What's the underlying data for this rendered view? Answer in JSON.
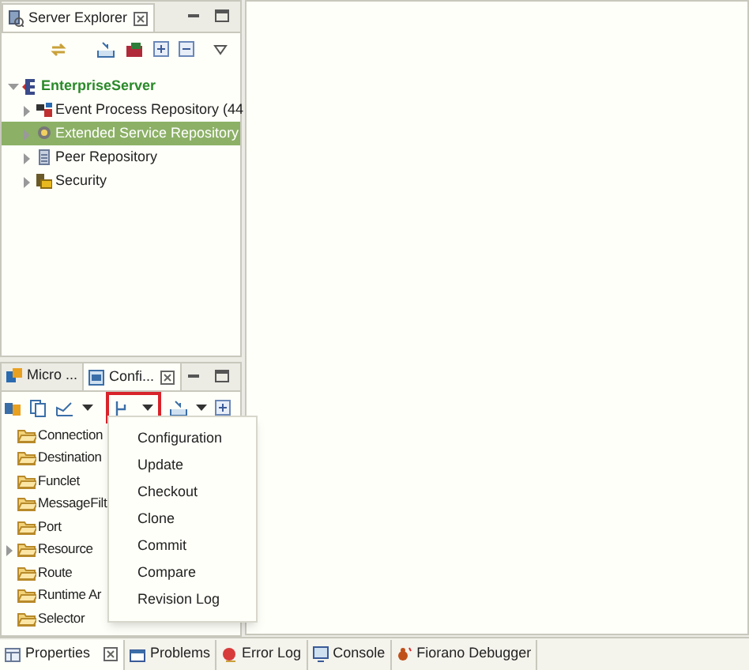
{
  "server_explorer": {
    "tab": {
      "label": "Server Explorer",
      "selected": true
    },
    "tree": {
      "label": "EnterpriseServer",
      "expanded": true,
      "children": [
        {
          "label": "Event Process Repository (44",
          "selected": false
        },
        {
          "label": "Extended Service Repository",
          "selected": true
        },
        {
          "label": "Peer Repository",
          "selected": false
        },
        {
          "label": "Security",
          "selected": false
        }
      ]
    }
  },
  "config_panel": {
    "tabs": [
      {
        "label": "Micro ...",
        "selected": false
      },
      {
        "label": "Confi...",
        "selected": true
      }
    ],
    "tree": [
      {
        "label": "Connection",
        "expandable": false
      },
      {
        "label": "Destination",
        "expandable": false
      },
      {
        "label": "Funclet",
        "expandable": false
      },
      {
        "label": "MessageFilt",
        "expandable": false
      },
      {
        "label": "Port",
        "expandable": false
      },
      {
        "label": "Resource",
        "expandable": true
      },
      {
        "label": "Route",
        "expandable": false
      },
      {
        "label": "Runtime Ar",
        "expandable": false
      },
      {
        "label": "Selector",
        "expandable": false
      }
    ]
  },
  "dropdown_menu": {
    "items": [
      "Configuration",
      "Update",
      "Checkout",
      "Clone",
      "Commit",
      "Compare",
      "Revision Log"
    ]
  },
  "bottom_tabs": [
    {
      "label": "Properties",
      "selected": true
    },
    {
      "label": "Problems",
      "selected": false
    },
    {
      "label": "Error Log",
      "selected": false
    },
    {
      "label": "Console",
      "selected": false
    },
    {
      "label": "Fiorano Debugger",
      "selected": false
    }
  ]
}
